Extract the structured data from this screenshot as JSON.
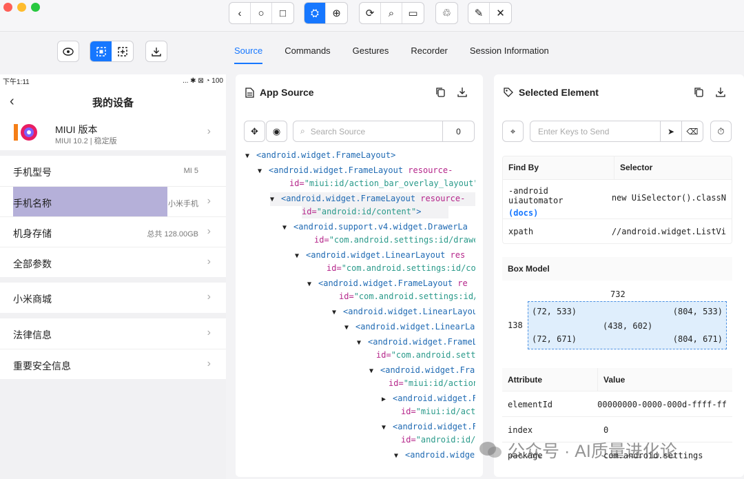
{
  "toolbar": {
    "back": "‹",
    "home": "○",
    "square": "□",
    "inspect": "⛭",
    "globe": "⊕",
    "refresh": "⟳",
    "search": "⌕",
    "video": "▭",
    "recycle": "♲",
    "wand": "✎",
    "close": "✕"
  },
  "tabs": [
    "Source",
    "Commands",
    "Gestures",
    "Recorder",
    "Session Information"
  ],
  "phone": {
    "status_time": "下午1:11",
    "status_icons": "... ✱ ⊠ ◔ 100",
    "title": "我的设备",
    "back": "‹",
    "miui_title": "MIUI 版本",
    "miui_sub": "MIUI 10.2 | 稳定版",
    "rows": [
      {
        "label": "手机型号",
        "value": "MI 5"
      },
      {
        "label": "手机名称",
        "value": "小米手机"
      },
      {
        "label": "机身存储",
        "value": "总共 128.00GB"
      },
      {
        "label": "全部参数",
        "value": ""
      },
      {
        "label": "小米商城",
        "value": ""
      },
      {
        "label": "法律信息",
        "value": ""
      },
      {
        "label": "重要安全信息",
        "value": ""
      }
    ],
    "chevron": "›"
  },
  "source": {
    "title": "App Source",
    "search_placeholder": "Search Source",
    "count": "0",
    "lines": [
      {
        "tag": "<android.widget.FrameLayout>",
        "attr": "",
        "val": "",
        "tail": ""
      },
      {
        "tag": "<android.widget.FrameLayout",
        "attr": " resource-",
        "val": "",
        "tail": ""
      },
      {
        "tag": "",
        "attr": "id=",
        "val": "\"miui:id/action_bar_overlay_layout\"",
        "tail": ">"
      },
      {
        "tag": "<android.widget.FrameLayout",
        "attr": " resource-",
        "val": "",
        "tail": ""
      },
      {
        "tag": "",
        "attr": "id=",
        "val": "\"android:id/content\"",
        "tail": ">"
      },
      {
        "tag": "<android.support.v4.widget.DrawerLa",
        "attr": "",
        "val": "",
        "tail": ""
      },
      {
        "tag": "",
        "attr": "id=",
        "val": "\"com.android.settings:id/drawer_",
        "tail": ""
      },
      {
        "tag": "<android.widget.LinearLayout",
        "attr": " res",
        "val": "",
        "tail": ""
      },
      {
        "tag": "",
        "attr": "id=",
        "val": "\"com.android.settings:id/cont",
        "tail": ""
      },
      {
        "tag": "<android.widget.FrameLayout",
        "attr": " re",
        "val": "",
        "tail": ""
      },
      {
        "tag": "",
        "attr": "id=",
        "val": "\"com.android.settings:id/co",
        "tail": ""
      },
      {
        "tag": "<android.widget.LinearLayou",
        "attr": "",
        "val": "",
        "tail": ""
      },
      {
        "tag": "<android.widget.LinearLay",
        "attr": "",
        "val": "",
        "tail": ""
      },
      {
        "tag": "<android.widget.FrameL",
        "attr": "",
        "val": "",
        "tail": ""
      },
      {
        "tag": "",
        "attr": "id=",
        "val": "\"com.android.settin",
        "tail": ""
      },
      {
        "tag": "<android.widget.Fran",
        "attr": "",
        "val": "",
        "tail": ""
      },
      {
        "tag": "",
        "attr": "id=",
        "val": "\"miui:id/action_b",
        "tail": ""
      },
      {
        "tag": "<android.widget.F",
        "attr": "",
        "val": "",
        "tail": ""
      },
      {
        "tag": "",
        "attr": "id=",
        "val": "\"miui:id/actio",
        "tail": ""
      },
      {
        "tag": "<android.widget.F",
        "attr": "",
        "val": "",
        "tail": ""
      },
      {
        "tag": "",
        "attr": "id=",
        "val": "\"android:id/co",
        "tail": ""
      },
      {
        "tag": "<android.widget",
        "attr": "",
        "val": "",
        "tail": ""
      }
    ]
  },
  "selected": {
    "title": "Selected Element",
    "keys_placeholder": "Enter Keys to Send",
    "find_by_header": "Find By",
    "selector_header": "Selector",
    "find_rows": [
      {
        "by": "-android uiautomator",
        "by2": "(docs)",
        "sel": "new UiSelector().classN"
      },
      {
        "by": "xpath",
        "by2": "",
        "sel": "//android.widget.ListVi"
      }
    ],
    "box_model_title": "Box Model",
    "box_width": "732",
    "box_height": "138",
    "tl": "(72, 533)",
    "tr": "(804, 533)",
    "center": "(438, 602)",
    "bl": "(72, 671)",
    "br": "(804, 671)",
    "attr_header": "Attribute",
    "value_header": "Value",
    "attrs": [
      {
        "k": "elementId",
        "v": "00000000-0000-000d-ffff-ff"
      },
      {
        "k": "index",
        "v": "0"
      },
      {
        "k": "package",
        "v": "com.android.settings"
      }
    ]
  },
  "watermark": "公众号 · AI质量进化论"
}
